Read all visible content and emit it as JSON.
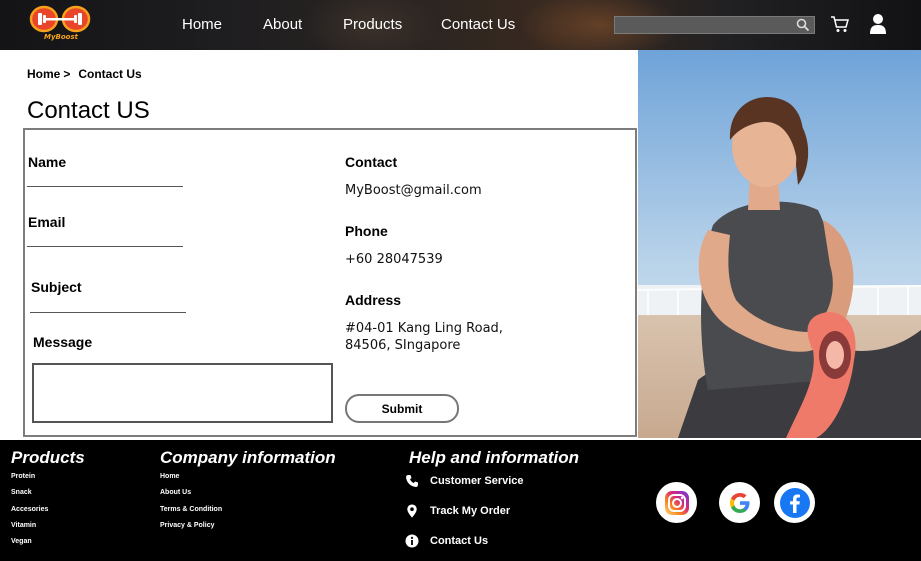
{
  "brand": {
    "name": "MyBoost",
    "accent": "#f7a21b",
    "logo_red": "#e8452a"
  },
  "nav": {
    "items": [
      {
        "label": "Home"
      },
      {
        "label": "About"
      },
      {
        "label": "Products"
      },
      {
        "label": "Contact Us"
      }
    ],
    "search": {
      "placeholder": "",
      "icon": "search-icon"
    },
    "cart_icon": "cart-icon",
    "user_icon": "user-icon"
  },
  "breadcrumb": {
    "home": "Home",
    "separator": ">",
    "current": "Contact Us"
  },
  "page_title": "Contact US",
  "form": {
    "name_label": "Name",
    "email_label": "Email",
    "subject_label": "Subject",
    "message_label": "Message",
    "submit_label": "Submit"
  },
  "contact_info": {
    "contact_label": "Contact",
    "email": "MyBoost@gmail.com",
    "phone_label": "Phone",
    "phone": "+60 28047539",
    "address_label": "Address",
    "address_line1": "#04-01 Kang Ling Road,",
    "address_line2": "84506, SIngapore"
  },
  "footer": {
    "products": {
      "heading": "Products",
      "links": [
        "Protein",
        "Snack",
        "Accesories",
        "Vitamin",
        "Vegan"
      ]
    },
    "company": {
      "heading": "Company information",
      "links": [
        "Home",
        "About Us",
        "Terms & Condition",
        "Privacy & Policy"
      ]
    },
    "help": {
      "heading": "Help and information",
      "items": [
        {
          "label": "Customer Service",
          "icon": "phone-icon"
        },
        {
          "label": "Track My Order",
          "icon": "location-pin-icon"
        },
        {
          "label": "Contact Us",
          "icon": "info-icon"
        }
      ]
    },
    "social": [
      "instagram-icon",
      "google-icon",
      "facebook-icon"
    ]
  }
}
